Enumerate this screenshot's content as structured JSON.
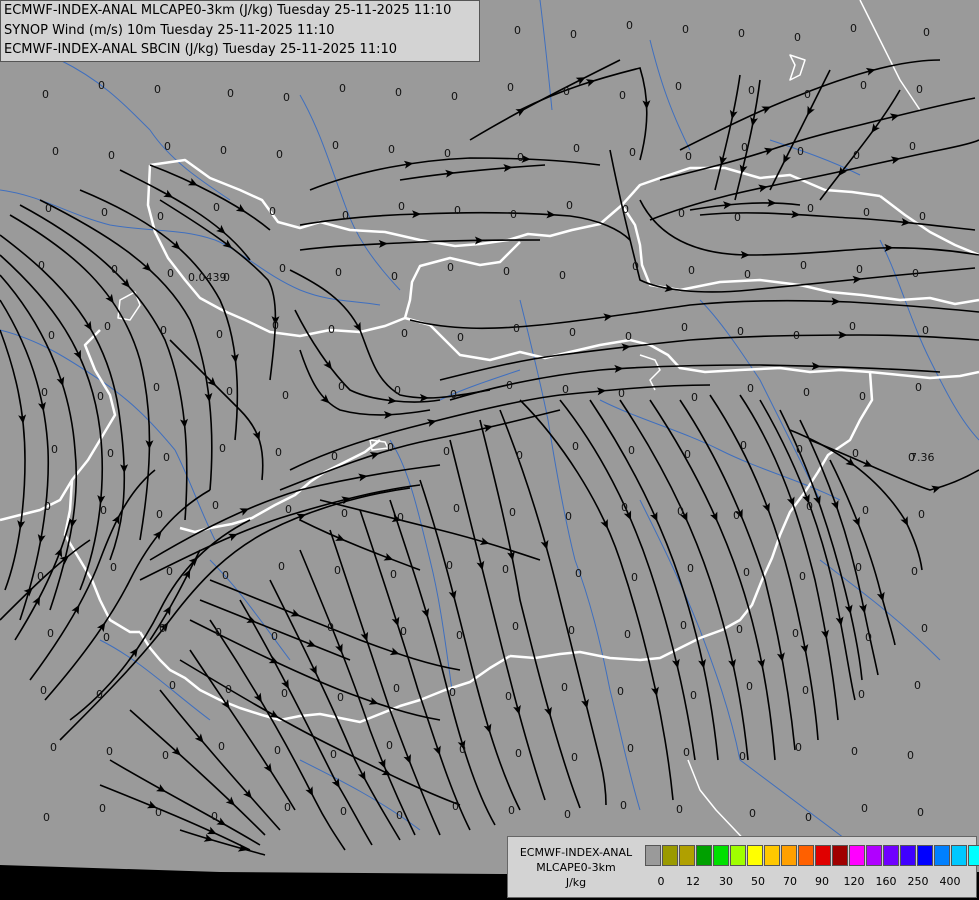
{
  "header": {
    "line1": "ECMWF-INDEX-ANAL MLCAPE0-3km (J/kg) Tuesday 25-11-2025 11:10",
    "line2": "SYNOP Wind (m/s) 10m Tuesday 25-11-2025 11:10",
    "line3": "ECMWF-INDEX-ANAL SBCIN (J/kg) Tuesday 25-11-2025 11:10"
  },
  "legend": {
    "title1": "ECMWF-INDEX-ANAL",
    "title2": "MLCAPE0-3km",
    "unit": "J/kg",
    "colors": [
      "#9a9a9a",
      "#9a9a00",
      "#b0a000",
      "#00a000",
      "#00e000",
      "#a0ff00",
      "#ffff00",
      "#ffc800",
      "#ffa000",
      "#ff6000",
      "#e00000",
      "#a00000",
      "#ff00ff",
      "#b000ff",
      "#7000ff",
      "#4000ff",
      "#0000ff",
      "#0080ff",
      "#00c8ff",
      "#00ffff",
      "#80ffff",
      "#ffffff"
    ],
    "ticks": [
      "0",
      "12",
      "30",
      "50",
      "70",
      "90",
      "120",
      "160",
      "250",
      "400"
    ]
  },
  "colors": {
    "background": "#9a9a9a",
    "national_border": "#ffffff",
    "rivers": "#3f6fbf",
    "streamlines": "#000000",
    "panel": "#d3d3d3"
  },
  "station_values": {
    "common": "0",
    "special": [
      "0.0439",
      "7.36"
    ]
  }
}
